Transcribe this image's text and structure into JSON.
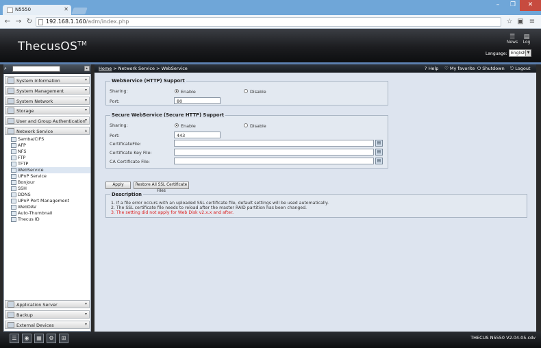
{
  "browser": {
    "tab_title": "N5550",
    "url_host": "192.168.1.160",
    "url_path": "/adm/index.php"
  },
  "header": {
    "logo": "ThecusOS",
    "logo_tm": "TM",
    "news_label": "News",
    "log_label": "Log",
    "language_label": "Language:",
    "language_value": "English"
  },
  "toolbar": {
    "breadcrumb_home": "Home",
    "breadcrumb_rest": " > Network Service > WebService",
    "help": "Help",
    "my_favorite": "My favorite",
    "shutdown": "Shutdown",
    "logout": "Logout"
  },
  "sidebar": {
    "menus_top": [
      {
        "label": "System Information"
      },
      {
        "label": "System Management"
      },
      {
        "label": "System Network"
      },
      {
        "label": "Storage"
      },
      {
        "label": "User and Group Authentication"
      },
      {
        "label": "Network Service"
      }
    ],
    "network_items": [
      {
        "label": "Samba/CIFS"
      },
      {
        "label": "AFP"
      },
      {
        "label": "NFS"
      },
      {
        "label": "FTP"
      },
      {
        "label": "TFTP"
      },
      {
        "label": "WebService"
      },
      {
        "label": "UPnP Service"
      },
      {
        "label": "Bonjour"
      },
      {
        "label": "SSH"
      },
      {
        "label": "DDNS"
      },
      {
        "label": "UPnP Port Management"
      },
      {
        "label": "WebDAV"
      },
      {
        "label": "Auto-Thumbnail"
      },
      {
        "label": "Thecus ID"
      }
    ],
    "menus_bottom": [
      {
        "label": "Application Server"
      },
      {
        "label": "Backup"
      },
      {
        "label": "External Devices"
      }
    ]
  },
  "http": {
    "title": "WebService (HTTP) Support",
    "sharing_label": "Sharing:",
    "enable": "Enable",
    "disable": "Disable",
    "port_label": "Port:",
    "port_value": "80"
  },
  "https": {
    "title": "Secure WebService (Secure HTTP) Support",
    "sharing_label": "Sharing:",
    "enable": "Enable",
    "disable": "Disable",
    "port_label": "Port:",
    "port_value": "443",
    "cert_label": "CertificateFile:",
    "key_label": "Certificate Key File:",
    "ca_label": "CA Certificate File:"
  },
  "actions": {
    "apply": "Apply",
    "restore": "Restore All SSL Certificate Files"
  },
  "description": {
    "title": "Description",
    "line1": "1. If a file error occurs with an uploaded SSL certificate file, default settings will be used automatically.",
    "line2": "2. The SSL certificate file needs to reload after the master RAID partition has been changed.",
    "line3": "3. The setting did not apply for Web Disk v2.x.x and after."
  },
  "footer": {
    "version": "THECUS N5550 V2.04.05.cdv"
  },
  "colors": {
    "accent": "#5b7fae",
    "warning_text": "#dd2222"
  }
}
